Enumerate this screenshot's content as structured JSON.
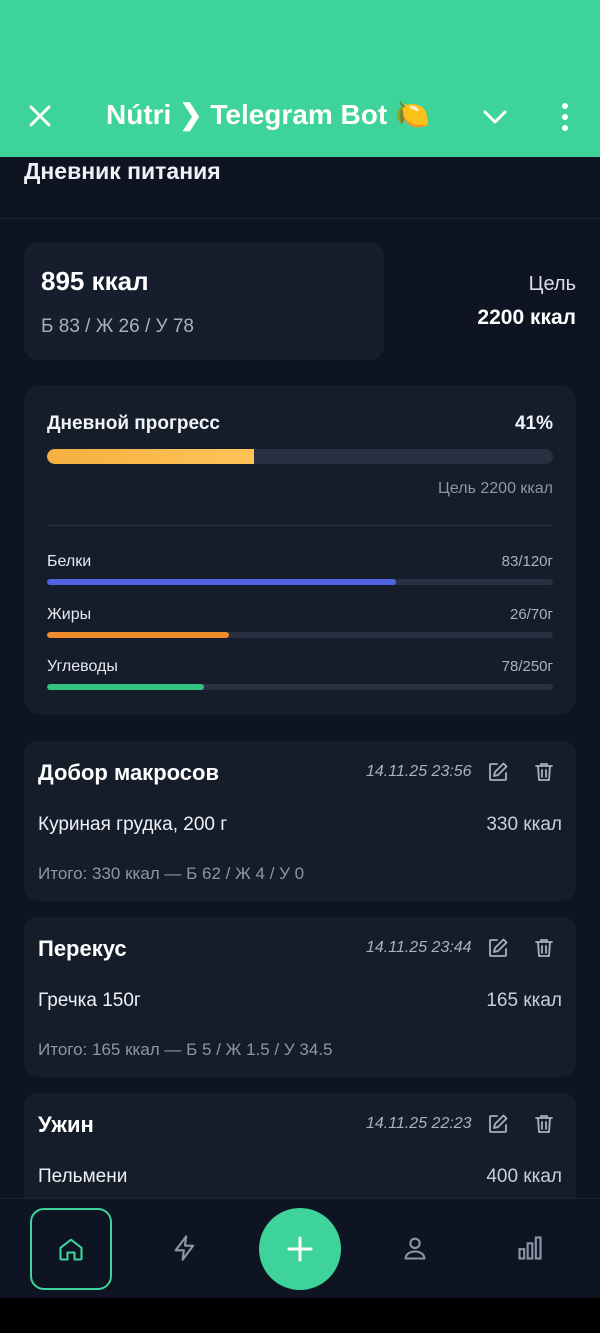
{
  "header": {
    "title": "Nútri ❯ Telegram Bot 🍋",
    "colors": {
      "accent": "#3dd39a"
    }
  },
  "page": {
    "title": "Дневник питания"
  },
  "summary": {
    "kcal": "895 ккал",
    "macros": "Б 83 / Ж 26 / У 78",
    "goal_label": "Цель",
    "goal_value": "2200 ккал"
  },
  "progress": {
    "title": "Дневной прогресс",
    "percent_label": "41%",
    "percent": 41,
    "goal": "Цель 2200 ккал",
    "macros": [
      {
        "label": "Белки",
        "value": "83/120г",
        "fraction": 0.69,
        "color": "#4f63e0"
      },
      {
        "label": "Жиры",
        "value": "26/70г",
        "fraction": 0.36,
        "color": "#f08a2a"
      },
      {
        "label": "Углеводы",
        "value": "78/250г",
        "fraction": 0.31,
        "color": "#33c27f"
      }
    ]
  },
  "meals": [
    {
      "name": "Добор макросов",
      "time": "14.11.25 23:56",
      "item": "Куриная грудка, 200 г",
      "item_kcal": "330 ккал",
      "total": "Итого: 330 ккал — Б 62 / Ж 4 / У 0"
    },
    {
      "name": "Перекус",
      "time": "14.11.25 23:44",
      "item": "Гречка 150г",
      "item_kcal": "165 ккал",
      "total": "Итого: 165 ккал — Б 5 / Ж 1.5 / У 34.5"
    },
    {
      "name": "Ужин",
      "time": "14.11.25 22:23",
      "item": "Пельмени",
      "item_kcal": "400 ккал",
      "total": ""
    }
  ],
  "nav": {
    "items": [
      "home-icon",
      "lightning-icon",
      "plus-icon",
      "user-icon",
      "chart-icon"
    ]
  }
}
